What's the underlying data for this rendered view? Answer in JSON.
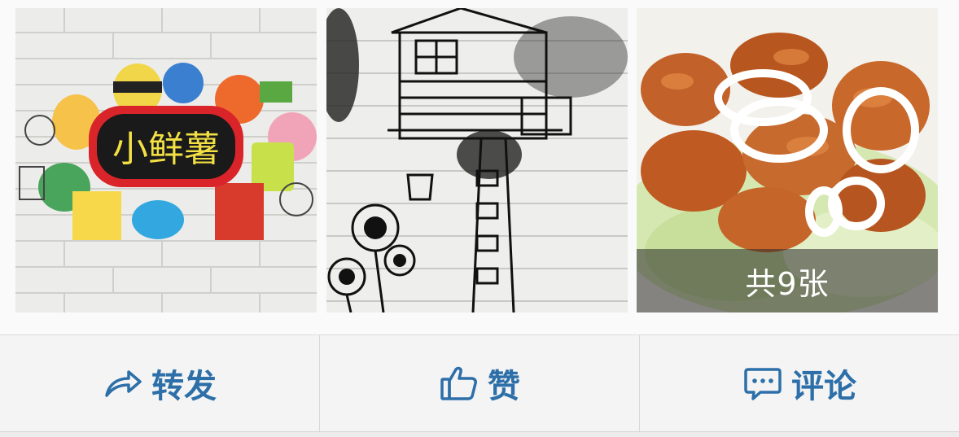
{
  "post": {
    "photos": [
      {
        "name": "photo-1",
        "kind": "graffiti-wall",
        "sign_text": "小鲜薯"
      },
      {
        "name": "photo-2",
        "kind": "treehouse-sketch"
      },
      {
        "name": "photo-3",
        "kind": "food-dish"
      }
    ],
    "photo_count_label": "共9张"
  },
  "actions": {
    "repost": {
      "label": "转发",
      "icon": "share-arrow-icon"
    },
    "like": {
      "label": "赞",
      "icon": "thumbs-up-icon"
    },
    "comment": {
      "label": "评论",
      "icon": "comment-bubble-icon"
    }
  },
  "colors": {
    "action_text": "#2d6fa8",
    "action_bar_bg": "#f4f4f4",
    "overlay_bg": "rgba(40,40,40,0.55)"
  }
}
